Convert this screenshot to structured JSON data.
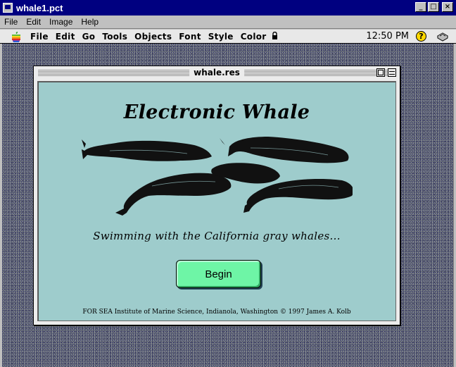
{
  "window": {
    "title": "whale1.pct",
    "controls": {
      "minimize": "_",
      "maximize": "□",
      "close": "×"
    }
  },
  "win_menu": [
    "File",
    "Edit",
    "Image",
    "Help"
  ],
  "mac_menu": {
    "items": [
      "File",
      "Edit",
      "Go",
      "Tools",
      "Objects",
      "Font",
      "Style",
      "Color"
    ],
    "clock": "12:50 PM",
    "help": "?"
  },
  "doc": {
    "title": "whale.res",
    "heading": "Electronic Whale",
    "subtitle": "Swimming with the California gray whales...",
    "button": "Begin",
    "credit": "FOR SEA Institute of Marine Science, Indianola, Washington  © 1997 James A. Kolb"
  },
  "icons": {
    "apple": "apple-icon",
    "lock": "lock-icon",
    "help": "help-icon",
    "app": "app-menu-icon",
    "whales": "whales-illustration"
  }
}
